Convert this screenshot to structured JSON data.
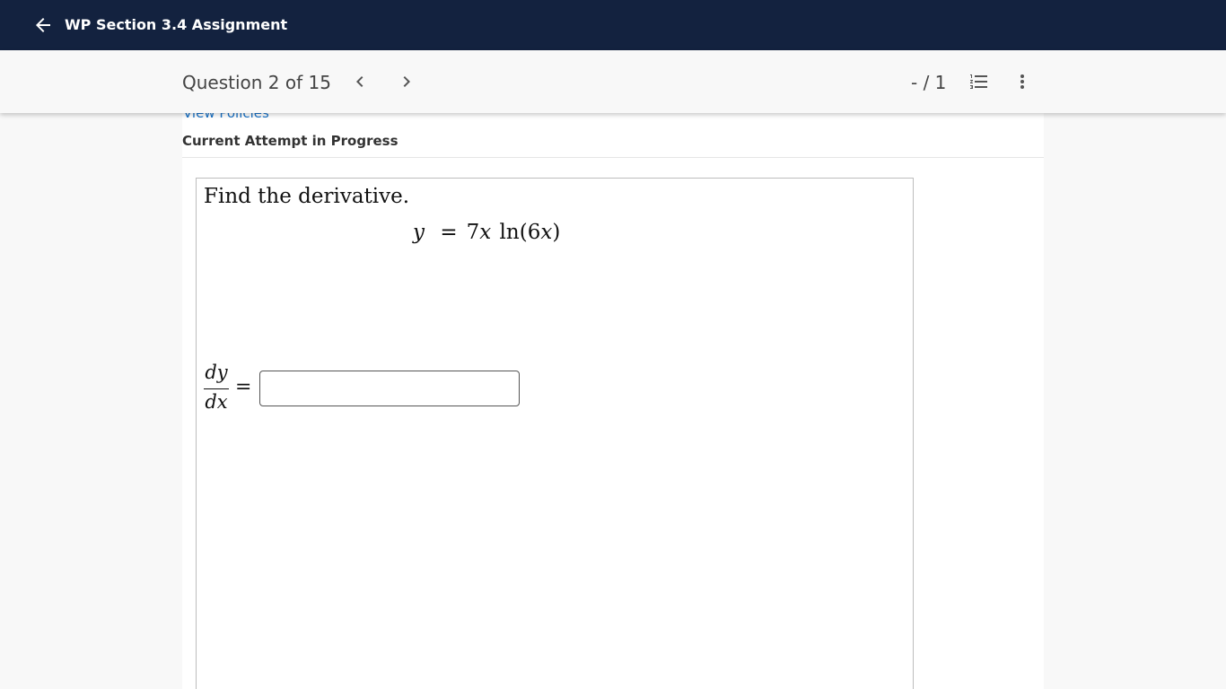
{
  "header": {
    "title": "WP Section 3.4 Assignment",
    "back_icon": "arrow-left-icon",
    "background_color": "#13223f"
  },
  "navbar": {
    "question_counter": "Question 2 of 15",
    "prev_icon": "chevron-left-icon",
    "next_icon": "chevron-right-icon",
    "score": "- / 1",
    "list_icon": "numbered-list-icon",
    "more_icon": "more-vertical-icon"
  },
  "content": {
    "policies_link": "View Policies",
    "attempt_status": "Current Attempt in Progress"
  },
  "question": {
    "prompt": "Find the derivative.",
    "equation": {
      "lhs": "y",
      "equals": "=",
      "coefficient": "7",
      "variable": "x",
      "function": "ln",
      "open_paren": "(",
      "inner_coefficient": "6",
      "inner_variable": "x",
      "close_paren": ")"
    },
    "answer": {
      "numerator": "dy",
      "denominator": "dx",
      "equals": "=",
      "value": "",
      "placeholder": ""
    }
  },
  "colors": {
    "link": "#1a73c8",
    "page_background": "#f8f8f8"
  }
}
